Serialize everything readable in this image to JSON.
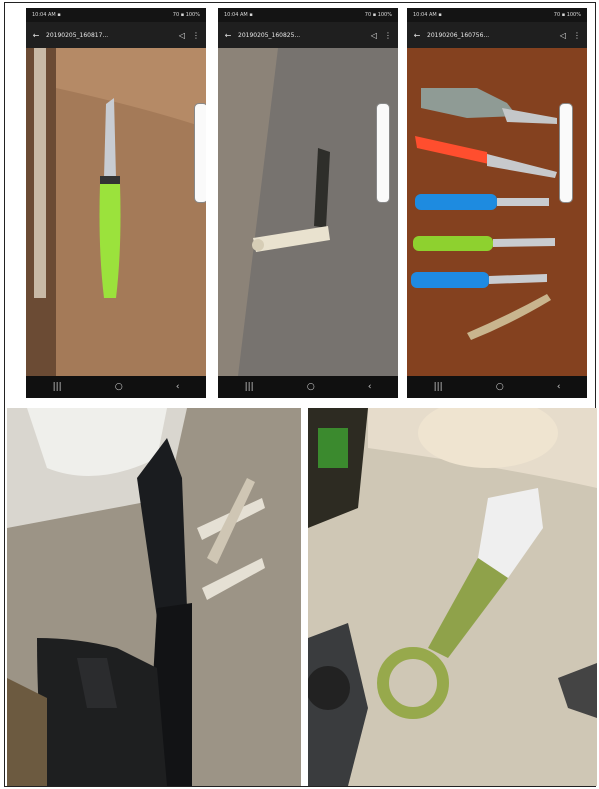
{
  "phones": [
    {
      "status_left": "10:04 AM ▪",
      "status_right": "70 ▪ 100%",
      "file_title": "20190205_160817..."
    },
    {
      "status_left": "10:04 AM ▪",
      "status_right": "70 ▪ 100%",
      "file_title": "20190205_160825..."
    },
    {
      "status_left": "10:04 AM ▪",
      "status_right": "70 ▪ 100%",
      "file_title": "20190206_160756..."
    }
  ],
  "icons": {
    "back": "back-arrow-icon",
    "share": "share-icon",
    "more": "more-vert-icon",
    "nav_recent": "recent-apps-icon",
    "nav_home": "home-icon",
    "nav_back": "nav-back-icon"
  },
  "glyphs": {
    "back": "←",
    "share": "◁",
    "more": "⋮",
    "recent": "|||",
    "home": "○",
    "navback": "‹"
  }
}
